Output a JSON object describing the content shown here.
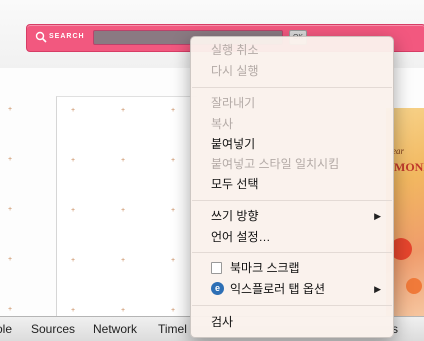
{
  "search": {
    "label": "SEARCH",
    "value": "",
    "ok_label": "OK"
  },
  "colors": {
    "accent": "#f2587f",
    "menu_bg": "#faf1ec",
    "disabled": "#b3aaa6"
  },
  "ad": {
    "line1": "ear",
    "line2": "MONE"
  },
  "devtools": {
    "tabs": [
      "ole",
      "Sources",
      "Network",
      "Timel",
      "s"
    ]
  },
  "context_menu": {
    "items": [
      {
        "label": "실행 취소",
        "disabled": true
      },
      {
        "label": "다시 실행",
        "disabled": true
      },
      {
        "label": "잘라내기",
        "disabled": true
      },
      {
        "label": "복사",
        "disabled": true
      },
      {
        "label": "붙여넣기",
        "disabled": false
      },
      {
        "label": "붙여넣고 스타일 일치시킴",
        "disabled": true
      },
      {
        "label": "모두 선택",
        "disabled": false
      },
      {
        "label": "쓰기 방향",
        "disabled": false,
        "submenu": true
      },
      {
        "label": "언어 설정…",
        "disabled": false
      },
      {
        "label": "북마크 스크랩",
        "disabled": false,
        "icon": "bookmark-icon"
      },
      {
        "label": "익스플로러 탭 옵션",
        "disabled": false,
        "icon": "ie-icon",
        "submenu": true
      },
      {
        "label": "검사",
        "disabled": false
      }
    ],
    "submenu_arrow": "▶"
  }
}
